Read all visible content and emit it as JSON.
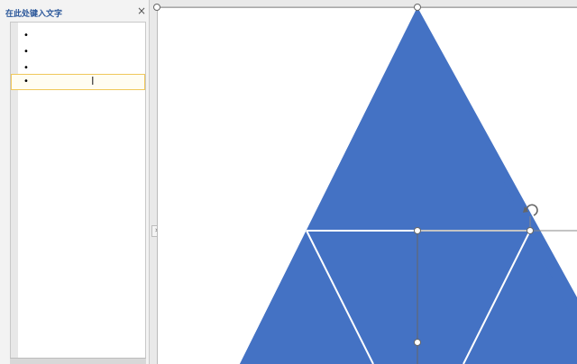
{
  "text_pane": {
    "title": "在此处键入文字",
    "close_glyph": "×",
    "bullet_glyph": "•",
    "items": [
      "",
      "",
      "",
      ""
    ]
  },
  "expand_glyph": "›",
  "colors": {
    "shape_fill": "#4472c4",
    "shape_outline": "#ffffff",
    "active_item_border": "#f0c85a",
    "pane_title": "#2b579a"
  },
  "icons": {
    "close": "close-icon",
    "cursor": "text-cursor-icon",
    "rotate": "rotate-handle-icon",
    "expand": "chevron-right-icon"
  }
}
